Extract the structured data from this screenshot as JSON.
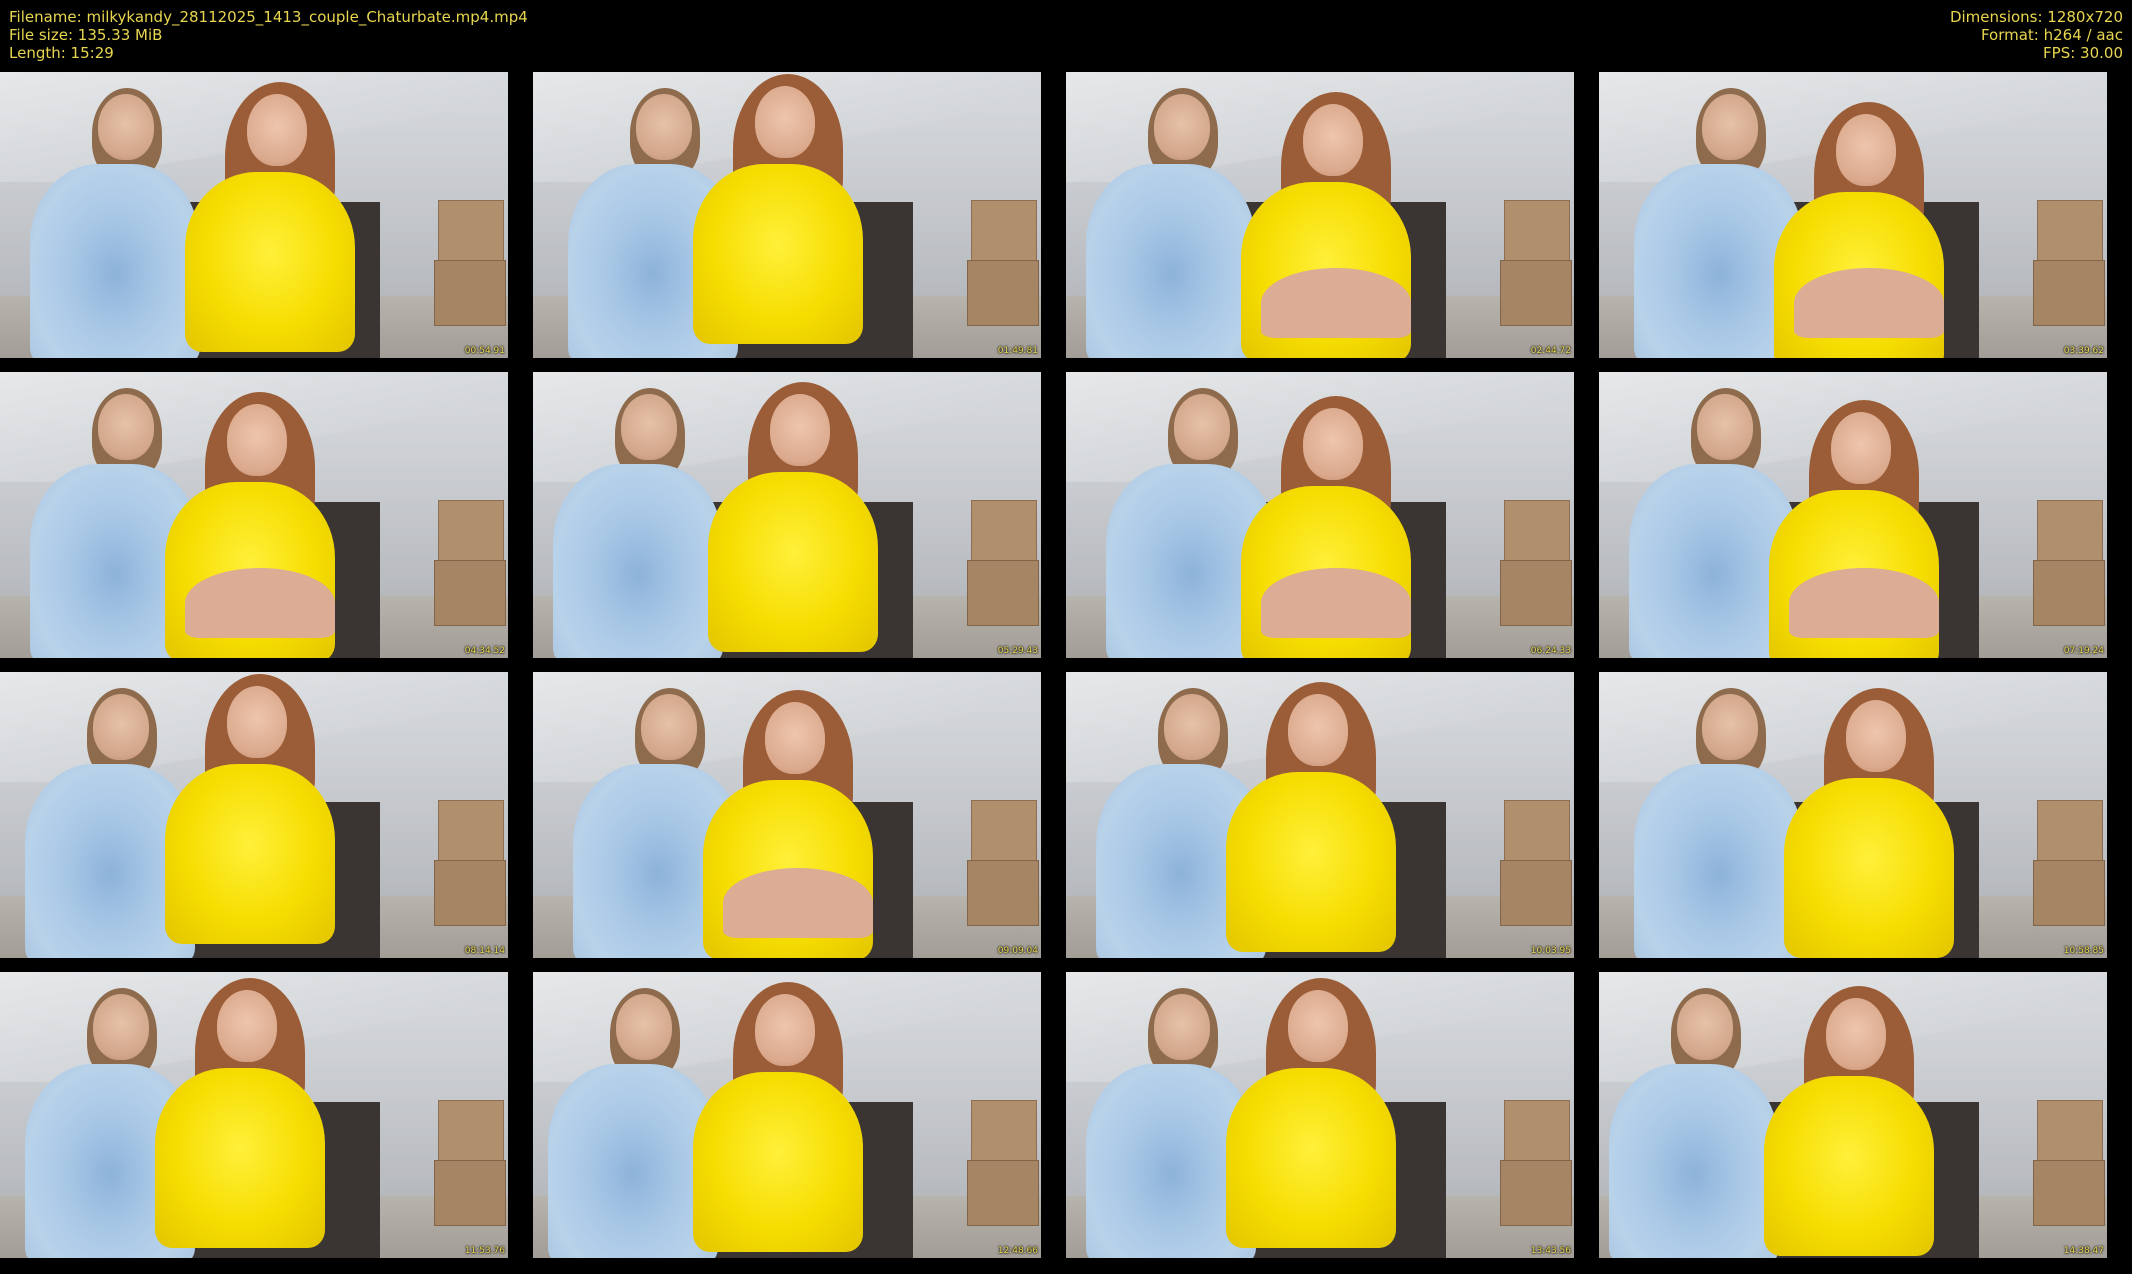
{
  "header": {
    "filename": "Filename: milkykandy_28112025_1413_couple_Chaturbate.mp4.mp4",
    "filesize": "File size: 135.33 MiB",
    "length": "Length: 15:29",
    "dimensions": "Dimensions: 1280x720",
    "format": "Format: h264 / aac",
    "fps": "FPS: 30.00"
  },
  "thumbnails": [
    {
      "timestamp": "00:54.91"
    },
    {
      "timestamp": "01:49.81"
    },
    {
      "timestamp": "02:44.72"
    },
    {
      "timestamp": "03:39.62"
    },
    {
      "timestamp": "04:34.52"
    },
    {
      "timestamp": "05:29.43"
    },
    {
      "timestamp": "06:24.33"
    },
    {
      "timestamp": "07:19.24"
    },
    {
      "timestamp": "08:14.14"
    },
    {
      "timestamp": "09:09.04"
    },
    {
      "timestamp": "10:03.95"
    },
    {
      "timestamp": "10:58.85"
    },
    {
      "timestamp": "11:53.76"
    },
    {
      "timestamp": "12:48.66"
    },
    {
      "timestamp": "13:43.56"
    },
    {
      "timestamp": "14:38.47"
    }
  ],
  "colors": {
    "meta_text": "#e8d650",
    "background": "#000000",
    "sweater_blue": "#a9c8e6",
    "top_yellow": "#f6dd00"
  }
}
